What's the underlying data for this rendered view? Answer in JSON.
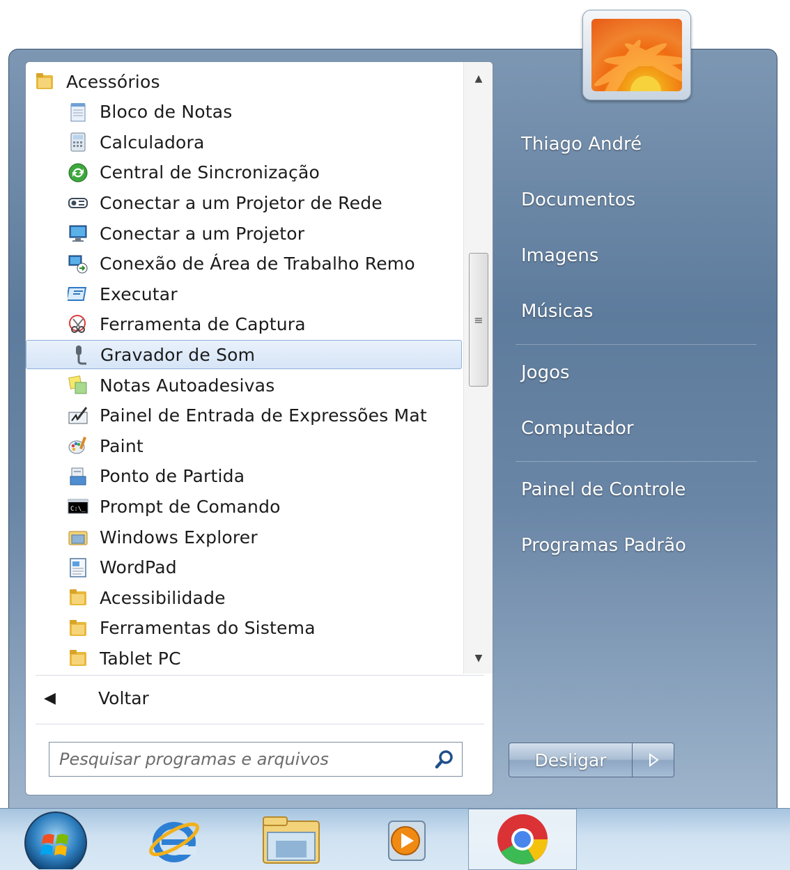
{
  "programs": {
    "items": [
      {
        "label": "Acessórios",
        "icon": "folder-icon",
        "kind": "folder-top"
      },
      {
        "label": "Bloco de Notas",
        "icon": "notepad-icon",
        "kind": "child"
      },
      {
        "label": "Calculadora",
        "icon": "calculator-icon",
        "kind": "child"
      },
      {
        "label": "Central de Sincronização",
        "icon": "sync-center-icon",
        "kind": "child"
      },
      {
        "label": "Conectar a um Projetor de Rede",
        "icon": "network-projector-icon",
        "kind": "child"
      },
      {
        "label": "Conectar a um Projetor",
        "icon": "projector-icon",
        "kind": "child"
      },
      {
        "label": "Conexão de Área de Trabalho Remo",
        "icon": "remote-desktop-icon",
        "kind": "child"
      },
      {
        "label": "Executar",
        "icon": "run-icon",
        "kind": "child"
      },
      {
        "label": "Ferramenta de Captura",
        "icon": "snipping-tool-icon",
        "kind": "child"
      },
      {
        "label": "Gravador de Som",
        "icon": "microphone-icon",
        "kind": "child",
        "selected": true
      },
      {
        "label": "Notas Autoadesivas",
        "icon": "sticky-notes-icon",
        "kind": "child"
      },
      {
        "label": "Painel de Entrada de Expressões Mat",
        "icon": "math-input-icon",
        "kind": "child"
      },
      {
        "label": "Paint",
        "icon": "paint-icon",
        "kind": "child"
      },
      {
        "label": "Ponto de Partida",
        "icon": "getting-started-icon",
        "kind": "child"
      },
      {
        "label": "Prompt de Comando",
        "icon": "command-prompt-icon",
        "kind": "child"
      },
      {
        "label": "Windows Explorer",
        "icon": "explorer-folder-icon",
        "kind": "child"
      },
      {
        "label": "WordPad",
        "icon": "wordpad-icon",
        "kind": "child"
      },
      {
        "label": "Acessibilidade",
        "icon": "folder-icon",
        "kind": "child"
      },
      {
        "label": "Ferramentas do Sistema",
        "icon": "folder-icon",
        "kind": "child"
      },
      {
        "label": "Tablet PC",
        "icon": "folder-icon",
        "kind": "child"
      }
    ]
  },
  "back": {
    "label": "Voltar"
  },
  "search": {
    "placeholder": "Pesquisar programas e arquivos"
  },
  "right_pane": {
    "user_name": "Thiago André",
    "documents": "Documentos",
    "pictures": "Imagens",
    "music": "Músicas",
    "games": "Jogos",
    "computer": "Computador",
    "control_panel": "Painel de Controle",
    "default_programs": "Programas Padrão"
  },
  "shutdown": {
    "label": "Desligar"
  },
  "taskbar": {
    "buttons": [
      "start-orb",
      "internet-explorer-icon",
      "windows-explorer-icon",
      "media-player-icon",
      "chrome-icon"
    ]
  },
  "colors": {
    "accent": "#6a86a6",
    "selection": "#d6e5f7",
    "taskbar": "#cfe1f1"
  }
}
